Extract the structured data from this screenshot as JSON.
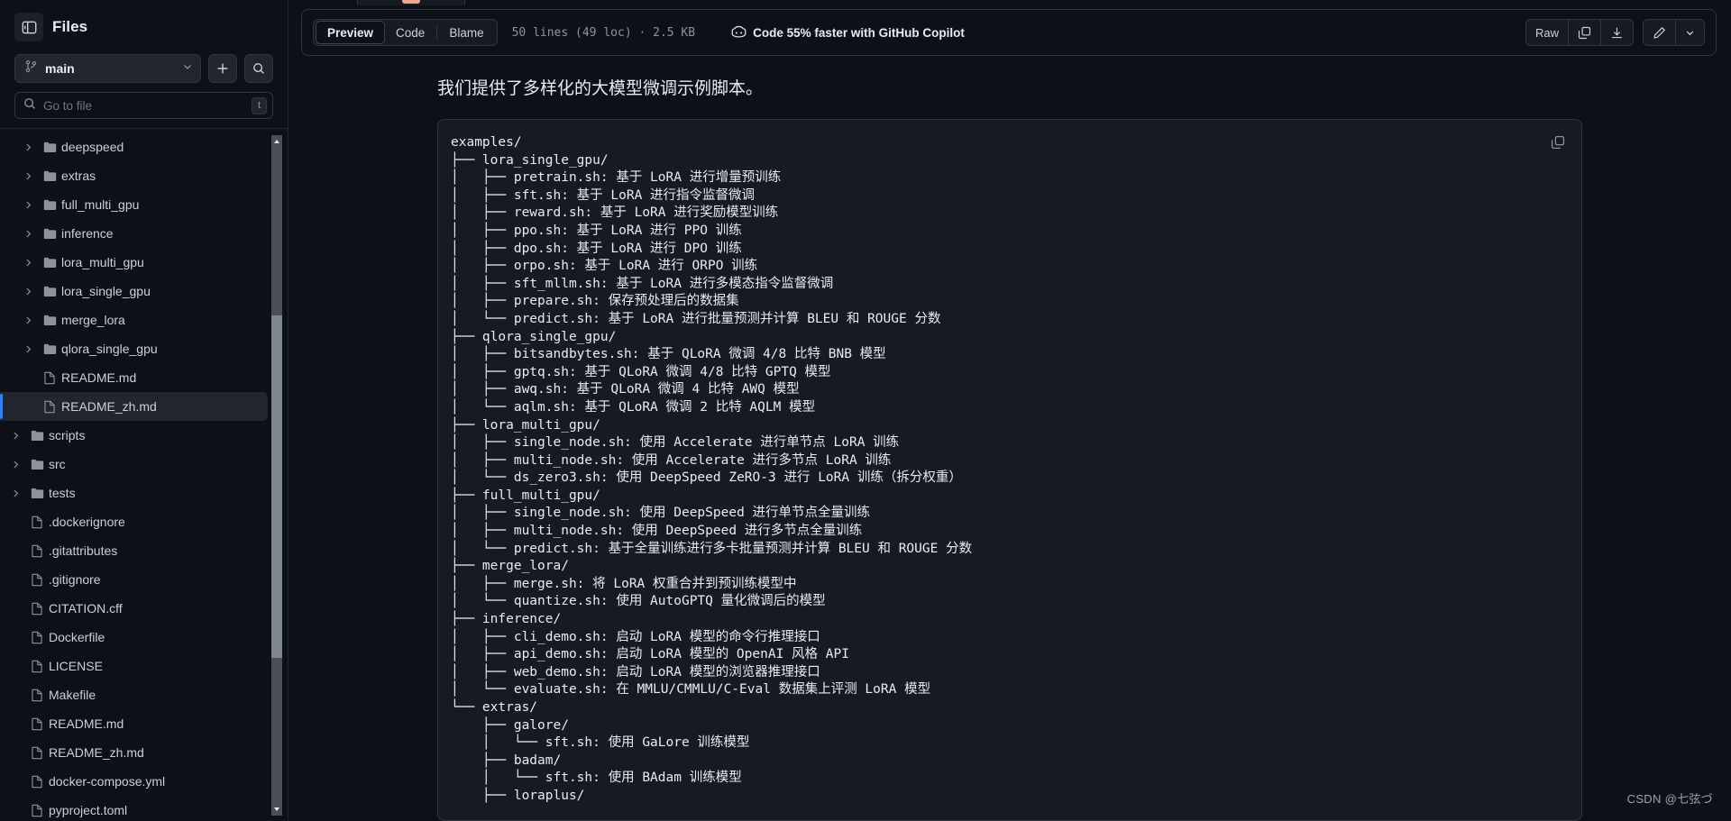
{
  "sidebar": {
    "title": "Files",
    "toggle_icon": "sidebar-toggle-icon",
    "branch": {
      "name": "main",
      "icon": "git-branch-icon",
      "caret": "chevron-down-icon"
    },
    "new_button_label": "+",
    "search_button_icon": "search-icon",
    "search": {
      "placeholder": "Go to file",
      "shortcut": "t",
      "icon": "search-icon"
    },
    "tree": [
      {
        "label": "deepspeed",
        "type": "folder",
        "depth": 1,
        "expandable": true,
        "selected": false
      },
      {
        "label": "extras",
        "type": "folder",
        "depth": 1,
        "expandable": true,
        "selected": false
      },
      {
        "label": "full_multi_gpu",
        "type": "folder",
        "depth": 1,
        "expandable": true,
        "selected": false
      },
      {
        "label": "inference",
        "type": "folder",
        "depth": 1,
        "expandable": true,
        "selected": false
      },
      {
        "label": "lora_multi_gpu",
        "type": "folder",
        "depth": 1,
        "expandable": true,
        "selected": false
      },
      {
        "label": "lora_single_gpu",
        "type": "folder",
        "depth": 1,
        "expandable": true,
        "selected": false
      },
      {
        "label": "merge_lora",
        "type": "folder",
        "depth": 1,
        "expandable": true,
        "selected": false
      },
      {
        "label": "qlora_single_gpu",
        "type": "folder",
        "depth": 1,
        "expandable": true,
        "selected": false
      },
      {
        "label": "README.md",
        "type": "file",
        "depth": 1,
        "expandable": false,
        "selected": false
      },
      {
        "label": "README_zh.md",
        "type": "file",
        "depth": 1,
        "expandable": false,
        "selected": true
      },
      {
        "label": "scripts",
        "type": "folder",
        "depth": 0,
        "expandable": true,
        "selected": false
      },
      {
        "label": "src",
        "type": "folder",
        "depth": 0,
        "expandable": true,
        "selected": false
      },
      {
        "label": "tests",
        "type": "folder",
        "depth": 0,
        "expandable": true,
        "selected": false
      },
      {
        "label": ".dockerignore",
        "type": "file",
        "depth": 0,
        "expandable": false,
        "selected": false
      },
      {
        "label": ".gitattributes",
        "type": "file",
        "depth": 0,
        "expandable": false,
        "selected": false
      },
      {
        "label": ".gitignore",
        "type": "file",
        "depth": 0,
        "expandable": false,
        "selected": false
      },
      {
        "label": "CITATION.cff",
        "type": "file",
        "depth": 0,
        "expandable": false,
        "selected": false
      },
      {
        "label": "Dockerfile",
        "type": "file",
        "depth": 0,
        "expandable": false,
        "selected": false
      },
      {
        "label": "LICENSE",
        "type": "file",
        "depth": 0,
        "expandable": false,
        "selected": false
      },
      {
        "label": "Makefile",
        "type": "file",
        "depth": 0,
        "expandable": false,
        "selected": false
      },
      {
        "label": "README.md",
        "type": "file",
        "depth": 0,
        "expandable": false,
        "selected": false
      },
      {
        "label": "README_zh.md",
        "type": "file",
        "depth": 0,
        "expandable": false,
        "selected": false
      },
      {
        "label": "docker-compose.yml",
        "type": "file",
        "depth": 0,
        "expandable": false,
        "selected": false
      },
      {
        "label": "pyproject.toml",
        "type": "file",
        "depth": 0,
        "expandable": false,
        "selected": false
      }
    ]
  },
  "toolbar": {
    "tabs": [
      {
        "label": "Preview",
        "active": true
      },
      {
        "label": "Code",
        "active": false
      },
      {
        "label": "Blame",
        "active": false
      }
    ],
    "meta": "50 lines (49 loc) · 2.5 KB",
    "copilot_label": "Code 55% faster with GitHub Copilot",
    "copilot_icon": "copilot-icon",
    "raw_label": "Raw",
    "copy_icon": "copy-icon",
    "download_icon": "download-icon",
    "edit_icon": "pencil-icon",
    "edit_caret_icon": "chevron-down-icon"
  },
  "document": {
    "heading": "我们提供了多样化的大模型微调示例脚本。",
    "code_copy_icon": "copy-icon",
    "code": "examples/\n├── lora_single_gpu/\n│   ├── pretrain.sh: 基于 LoRA 进行增量预训练\n│   ├── sft.sh: 基于 LoRA 进行指令监督微调\n│   ├── reward.sh: 基于 LoRA 进行奖励模型训练\n│   ├── ppo.sh: 基于 LoRA 进行 PPO 训练\n│   ├── dpo.sh: 基于 LoRA 进行 DPO 训练\n│   ├── orpo.sh: 基于 LoRA 进行 ORPO 训练\n│   ├── sft_mllm.sh: 基于 LoRA 进行多模态指令监督微调\n│   ├── prepare.sh: 保存预处理后的数据集\n│   └── predict.sh: 基于 LoRA 进行批量预测并计算 BLEU 和 ROUGE 分数\n├── qlora_single_gpu/\n│   ├── bitsandbytes.sh: 基于 QLoRA 微调 4/8 比特 BNB 模型\n│   ├── gptq.sh: 基于 QLoRA 微调 4/8 比特 GPTQ 模型\n│   ├── awq.sh: 基于 QLoRA 微调 4 比特 AWQ 模型\n│   └── aqlm.sh: 基于 QLoRA 微调 2 比特 AQLM 模型\n├── lora_multi_gpu/\n│   ├── single_node.sh: 使用 Accelerate 进行单节点 LoRA 训练\n│   ├── multi_node.sh: 使用 Accelerate 进行多节点 LoRA 训练\n│   └── ds_zero3.sh: 使用 DeepSpeed ZeRO-3 进行 LoRA 训练（拆分权重）\n├── full_multi_gpu/\n│   ├── single_node.sh: 使用 DeepSpeed 进行单节点全量训练\n│   ├── multi_node.sh: 使用 DeepSpeed 进行多节点全量训练\n│   └── predict.sh: 基于全量训练进行多卡批量预测并计算 BLEU 和 ROUGE 分数\n├── merge_lora/\n│   ├── merge.sh: 将 LoRA 权重合并到预训练模型中\n│   └── quantize.sh: 使用 AutoGPTQ 量化微调后的模型\n├── inference/\n│   ├── cli_demo.sh: 启动 LoRA 模型的命令行推理接口\n│   ├── api_demo.sh: 启动 LoRA 模型的 OpenAI 风格 API\n│   ├── web_demo.sh: 启动 LoRA 模型的浏览器推理接口\n│   └── evaluate.sh: 在 MMLU/CMMLU/C-Eval 数据集上评测 LoRA 模型\n└── extras/\n    ├── galore/\n    │   └── sft.sh: 使用 GaLore 训练模型\n    ├── badam/\n    │   └── sft.sh: 使用 BAdam 训练模型\n    ├── loraplus/"
  },
  "watermark": "CSDN @七弦づ",
  "colors": {
    "accent": "#2f81f7",
    "bg": "#0d1117",
    "panel": "#161b22",
    "border": "#30363d",
    "text": "#e6edf3",
    "muted": "#8b949e"
  }
}
